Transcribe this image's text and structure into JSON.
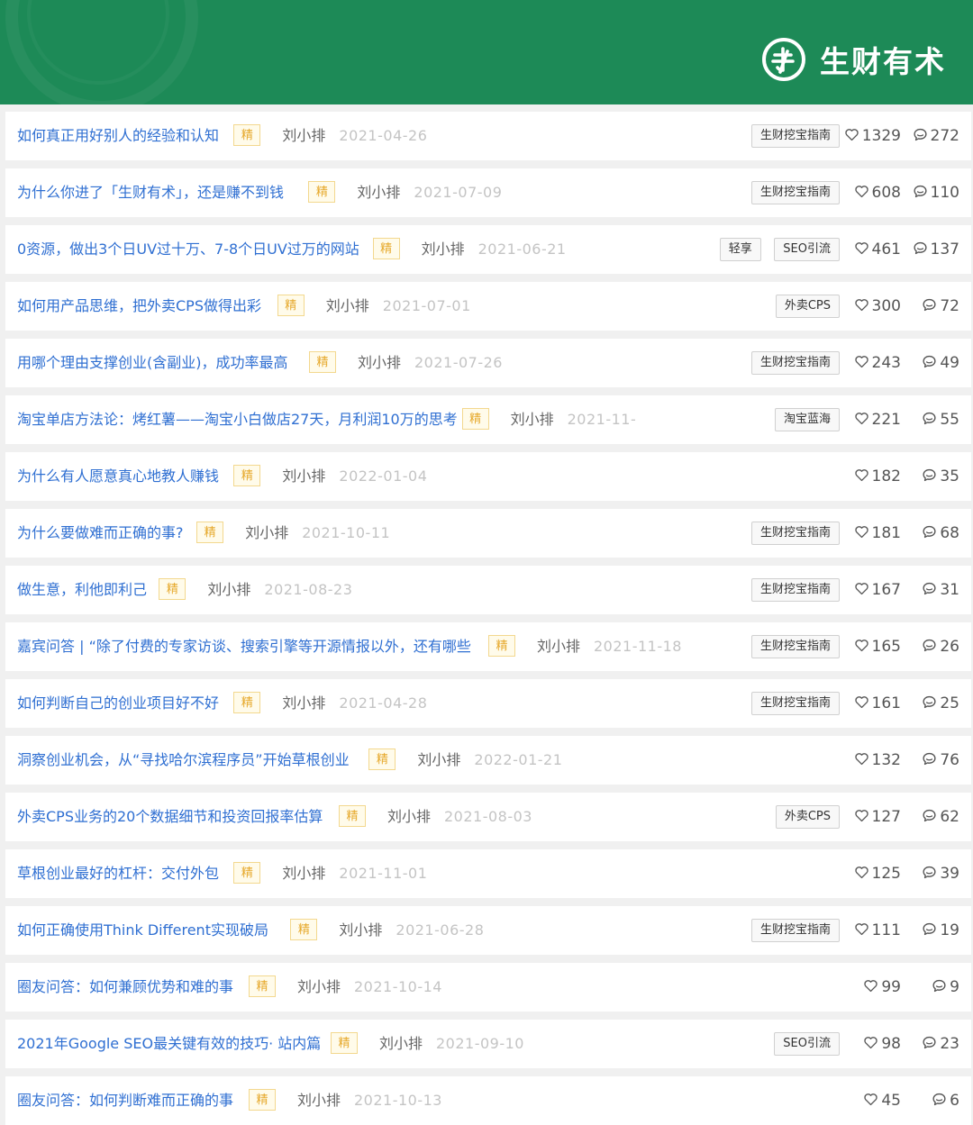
{
  "brand": {
    "name": "生财有术",
    "accent": "#1d8a57"
  },
  "jing_label": "精",
  "icons": {
    "like": "heart-icon",
    "comment": "comment-icon"
  },
  "posts": [
    {
      "title": "如何真正用好别人的经验和认知",
      "author": "刘小排",
      "date": "2021-04-26",
      "tags": [
        "生财挖宝指南"
      ],
      "likes": "1329",
      "comments": "272"
    },
    {
      "title": "为什么你进了「生财有术」，还是赚不到钱",
      "author": "刘小排",
      "date": "2021-07-09",
      "tags": [
        "生财挖宝指南"
      ],
      "likes": "608",
      "comments": "110"
    },
    {
      "title": "0资源，做出3个日UV过十万、7-8个日UV过万的网站",
      "author": "刘小排",
      "date": "2021-06-21",
      "tags": [
        "轻享",
        "SEO引流"
      ],
      "likes": "461",
      "comments": "137"
    },
    {
      "title": "如何用产品思维，把外卖CPS做得出彩",
      "author": "刘小排",
      "date": "2021-07-01",
      "tags": [
        "外卖CPS"
      ],
      "likes": "300",
      "comments": "72"
    },
    {
      "title": "用哪个理由支撑创业(含副业)，成功率最高",
      "author": "刘小排",
      "date": "2021-07-26",
      "tags": [
        "生财挖宝指南"
      ],
      "likes": "243",
      "comments": "49"
    },
    {
      "title": "淘宝单店方法论：烤红薯——淘宝小白做店27天，月利润10万的思考",
      "author": "刘小排",
      "date": "2021-11-",
      "tags": [
        "淘宝蓝海"
      ],
      "likes": "221",
      "comments": "55"
    },
    {
      "title": "为什么有人愿意真心地教人赚钱",
      "author": "刘小排",
      "date": "2022-01-04",
      "tags": [],
      "likes": "182",
      "comments": "35"
    },
    {
      "title": "为什么要做难而正确的事?",
      "author": "刘小排",
      "date": "2021-10-11",
      "tags": [
        "生财挖宝指南"
      ],
      "likes": "181",
      "comments": "68"
    },
    {
      "title": "做生意，利他即利己",
      "author": "刘小排",
      "date": "2021-08-23",
      "tags": [
        "生财挖宝指南"
      ],
      "likes": "167",
      "comments": "31"
    },
    {
      "title": "嘉宾问答 | “除了付费的专家访谈、搜索引擎等开源情报以外，还有哪些",
      "author": "刘小排",
      "date": "2021-11-18",
      "tags": [
        "生财挖宝指南"
      ],
      "likes": "165",
      "comments": "26"
    },
    {
      "title": "如何判断自己的创业项目好不好",
      "author": "刘小排",
      "date": "2021-04-28",
      "tags": [
        "生财挖宝指南"
      ],
      "likes": "161",
      "comments": "25"
    },
    {
      "title": "洞察创业机会，从“寻找哈尔滨程序员”开始草根创业",
      "author": "刘小排",
      "date": "2022-01-21",
      "tags": [],
      "likes": "132",
      "comments": "76"
    },
    {
      "title": "外卖CPS业务的20个数据细节和投资回报率估算",
      "author": "刘小排",
      "date": "2021-08-03",
      "tags": [
        "外卖CPS"
      ],
      "likes": "127",
      "comments": "62"
    },
    {
      "title": "草根创业最好的杠杆：交付外包",
      "author": "刘小排",
      "date": "2021-11-01",
      "tags": [],
      "likes": "125",
      "comments": "39"
    },
    {
      "title": "如何正确使用Think Different实现破局",
      "author": "刘小排",
      "date": "2021-06-28",
      "tags": [
        "生财挖宝指南"
      ],
      "likes": "111",
      "comments": "19"
    },
    {
      "title": "圈友问答：如何兼顾优势和难的事",
      "author": "刘小排",
      "date": "2021-10-14",
      "tags": [],
      "likes": "99",
      "comments": "9"
    },
    {
      "title": "2021年Google SEO最关键有效的技巧· 站内篇",
      "author": "刘小排",
      "date": "2021-09-10",
      "tags": [
        "SEO引流"
      ],
      "likes": "98",
      "comments": "23"
    },
    {
      "title": "圈友问答：如何判断难而正确的事",
      "author": "刘小排",
      "date": "2021-10-13",
      "tags": [],
      "likes": "45",
      "comments": "6"
    }
  ]
}
